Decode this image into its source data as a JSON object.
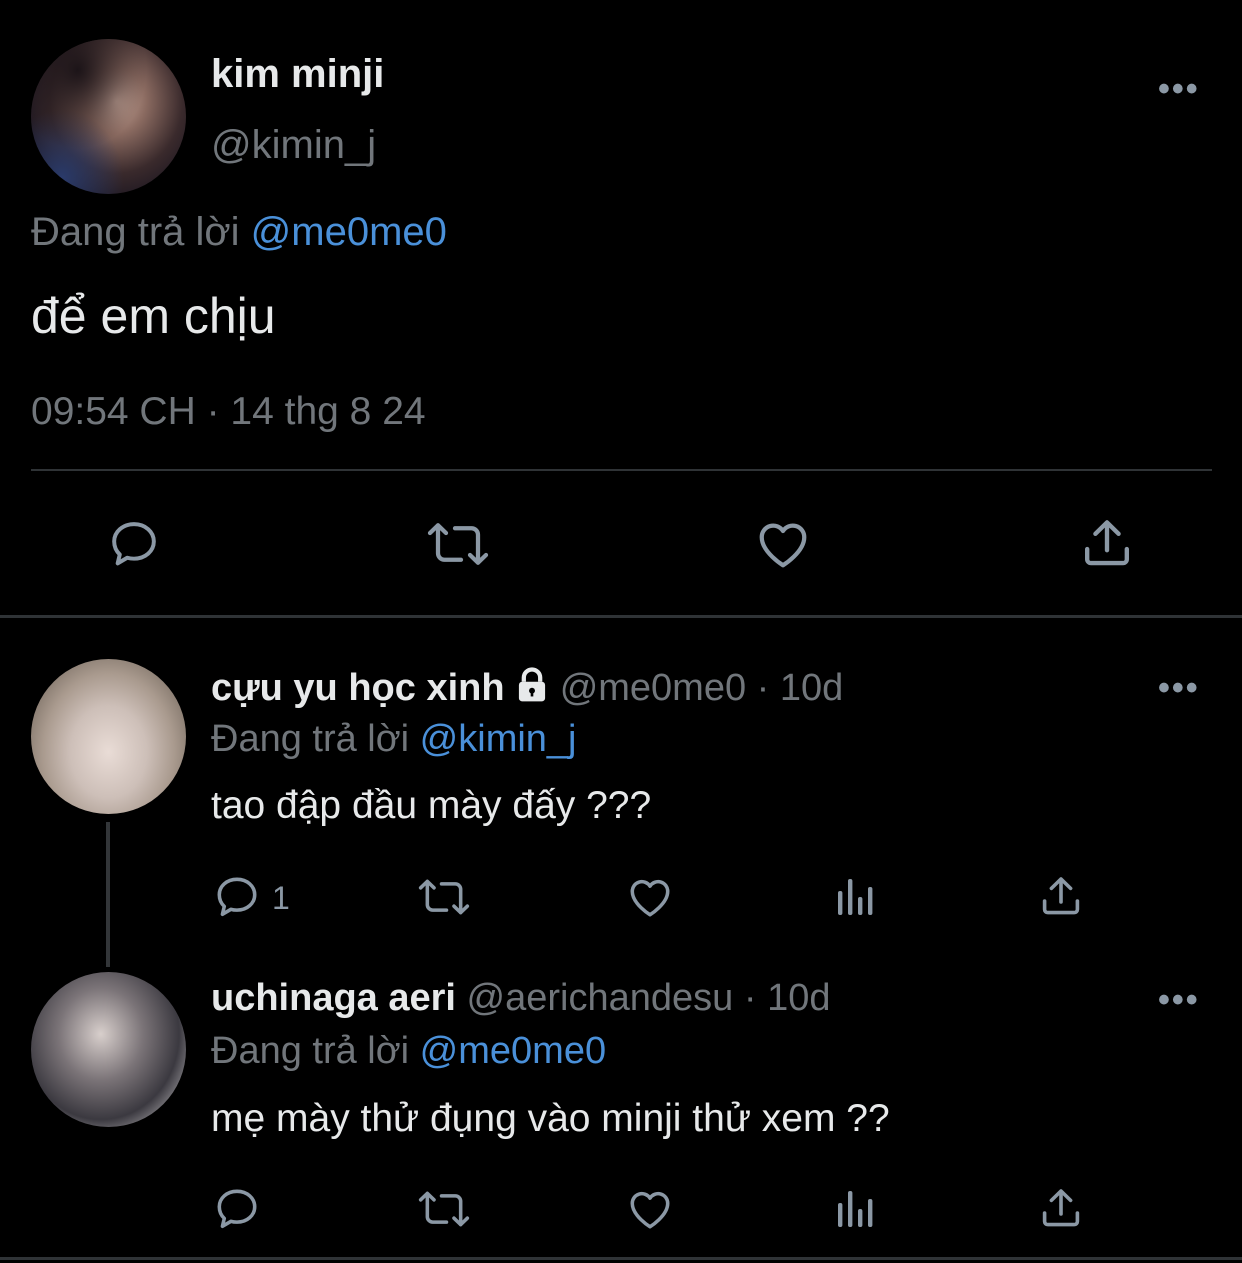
{
  "main_tweet": {
    "display_name": "kim minji",
    "handle": "@kimin_j",
    "replying_prefix": "Đang trả lời",
    "replying_to": "@me0me0",
    "text": "để em chịu",
    "timestamp": "09:54 CH · 14 thg 8 24",
    "actions": [
      "reply-icon",
      "retweet-icon",
      "like-icon",
      "share-icon"
    ]
  },
  "replies": [
    {
      "display_name": "cựu yu học xinh",
      "protected": true,
      "handle": "@me0me0",
      "age": "10d",
      "replying_prefix": "Đang trả lời",
      "replying_to": "@kimin_j",
      "text": "tao đập đầu mày đấy ???",
      "reply_count": "1"
    },
    {
      "display_name": "uchinaga aeri",
      "protected": false,
      "handle": "@aerichandesu",
      "age": "10d",
      "replying_prefix": "Đang trả lời",
      "replying_to": "@me0me0",
      "text": "mẹ mày thử đụng vào minji thử xem ??",
      "reply_count": ""
    }
  ],
  "separator": " · ",
  "menu_glyph": "•••",
  "colors": {
    "background": "#000000",
    "text": "#e7e9ea",
    "muted": "#71767b",
    "link": "#4a90d9",
    "icon": "#8b98a5"
  }
}
